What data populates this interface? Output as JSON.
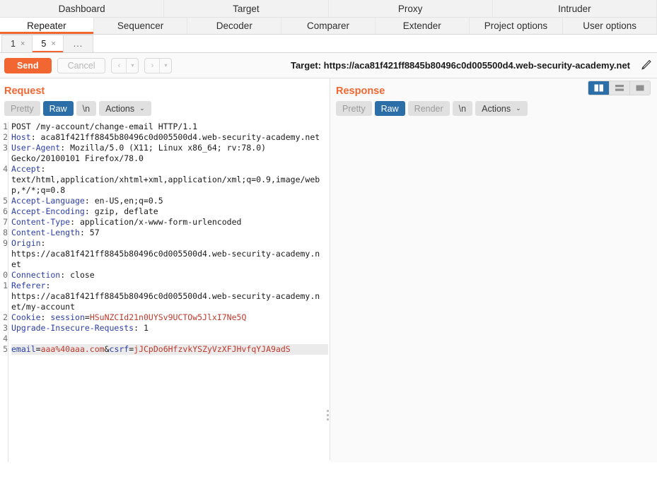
{
  "suite": {
    "row1": [
      {
        "label": "Dashboard",
        "active": false
      },
      {
        "label": "Target",
        "active": false
      },
      {
        "label": "Proxy",
        "active": false
      },
      {
        "label": "Intruder",
        "active": false
      }
    ],
    "row2": [
      {
        "label": "Repeater",
        "active": true
      },
      {
        "label": "Sequencer",
        "active": false
      },
      {
        "label": "Decoder",
        "active": false
      },
      {
        "label": "Comparer",
        "active": false
      },
      {
        "label": "Extender",
        "active": false
      },
      {
        "label": "Project options",
        "active": false
      },
      {
        "label": "User options",
        "active": false
      }
    ]
  },
  "repeater_tabs": [
    {
      "label": "1",
      "close": "×",
      "active": false
    },
    {
      "label": "5",
      "close": "×",
      "active": true
    }
  ],
  "repeater_more": "...",
  "toolbar": {
    "send_label": "Send",
    "cancel_label": "Cancel",
    "back_icon": "‹",
    "back_caret": "▾",
    "forward_icon": "›",
    "forward_caret": "▾",
    "target_label": "Target: https://aca81f421ff8845b80496c0d005500d4.web-security-academy.net",
    "edit_icon": "pencil-icon"
  },
  "request": {
    "title": "Request",
    "buttons": {
      "pretty": "Pretty",
      "raw": "Raw",
      "newline": "\\n",
      "actions": "Actions",
      "caret": "⌄"
    },
    "line_numbers": [
      "1",
      "2",
      "3",
      "",
      "4",
      "",
      "",
      "5",
      "6",
      "7",
      "8",
      "9",
      "",
      "",
      "0",
      "1",
      "",
      "",
      "2",
      "3",
      "4",
      "5"
    ],
    "lines": [
      {
        "type": "plain",
        "text": "POST /my-account/change-email HTTP/1.1"
      },
      {
        "type": "header",
        "name": "Host",
        "value": ": aca81f421ff8845b80496c0d005500d4.web-security-academy.net"
      },
      {
        "type": "header",
        "name": "User-Agent",
        "value": ": Mozilla/5.0 (X11; Linux x86_64; rv:78.0)"
      },
      {
        "type": "plain",
        "text": "Gecko/20100101 Firefox/78.0"
      },
      {
        "type": "header",
        "name": "Accept",
        "value": ":"
      },
      {
        "type": "plain",
        "text": "text/html,application/xhtml+xml,application/xml;q=0.9,image/web"
      },
      {
        "type": "plain",
        "text": "p,*/*;q=0.8"
      },
      {
        "type": "header",
        "name": "Accept-Language",
        "value": ": en-US,en;q=0.5"
      },
      {
        "type": "header",
        "name": "Accept-Encoding",
        "value": ": gzip, deflate"
      },
      {
        "type": "header",
        "name": "Content-Type",
        "value": ": application/x-www-form-urlencoded"
      },
      {
        "type": "header",
        "name": "Content-Length",
        "value": ": 57"
      },
      {
        "type": "header",
        "name": "Origin",
        "value": ":"
      },
      {
        "type": "plain",
        "text": "https://aca81f421ff8845b80496c0d005500d4.web-security-academy.n"
      },
      {
        "type": "plain",
        "text": "et"
      },
      {
        "type": "header",
        "name": "Connection",
        "value": ": close"
      },
      {
        "type": "header",
        "name": "Referer",
        "value": ":"
      },
      {
        "type": "plain",
        "text": "https://aca81f421ff8845b80496c0d005500d4.web-security-academy.n"
      },
      {
        "type": "plain",
        "text": "et/my-account"
      },
      {
        "type": "cookie",
        "prefix": "Cookie",
        "mid": ": ",
        "key": "session",
        "eq": "=",
        "value": "HSuNZCId21n0UYSv9UCTOw5JlxI7Ne5Q"
      },
      {
        "type": "header",
        "name": "Upgrade-Insecure-Requests",
        "value": ": 1"
      },
      {
        "type": "plain",
        "text": ""
      },
      {
        "type": "body",
        "selected": true,
        "k1": "email",
        "e1": "=",
        "v1": "aaa%40aaa.com",
        "amp": "&",
        "k2": "csrf",
        "e2": "=",
        "v2": "jJCpDo6HfzvkYSZyVzXFJHvfqYJA9adS"
      }
    ]
  },
  "response": {
    "title": "Response",
    "buttons": {
      "pretty": "Pretty",
      "raw": "Raw",
      "render": "Render",
      "newline": "\\n",
      "actions": "Actions",
      "caret": "⌄"
    },
    "content": "",
    "layout_toggles": [
      {
        "name": "side-by-side-layout-icon",
        "active": true
      },
      {
        "name": "stacked-layout-icon",
        "active": false
      },
      {
        "name": "single-pane-layout-icon",
        "active": false
      }
    ]
  },
  "colors": {
    "accent_orange": "#f26632",
    "accent_blue": "#2c6fa8",
    "header_key": "#2b3fa8",
    "param_value": "#c0392b"
  }
}
